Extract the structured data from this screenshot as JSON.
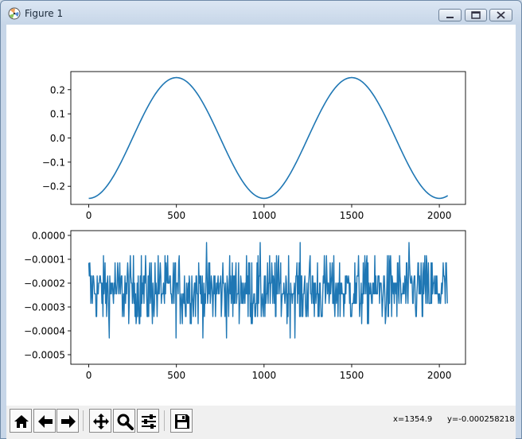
{
  "window": {
    "title": "Figure 1",
    "controls": [
      "minimize",
      "maximize",
      "close"
    ]
  },
  "toolbar": {
    "buttons": [
      {
        "name": "home",
        "icon": "home-icon"
      },
      {
        "name": "back",
        "icon": "arrow-left-icon"
      },
      {
        "name": "forward",
        "icon": "arrow-right-icon"
      },
      {
        "name": "pan",
        "icon": "move-icon"
      },
      {
        "name": "zoom",
        "icon": "magnifier-icon"
      },
      {
        "name": "configure-subplots",
        "icon": "sliders-icon"
      },
      {
        "name": "save",
        "icon": "floppy-disk-icon"
      }
    ],
    "x_readout": "x=1354.9",
    "y_readout": "y=-0.000258218"
  },
  "colors": {
    "series": "#1f77b4",
    "background": "#ffffff",
    "toolbar": "#f0f0f0"
  },
  "chart_data": [
    {
      "type": "line",
      "function": "-0.25*cos(2*pi*x/1000)",
      "x_range": [
        0,
        2048
      ],
      "xlim": [
        -102.35,
        2149.35
      ],
      "ylim": [
        -0.275,
        0.275
      ],
      "xticks": [
        0,
        500,
        1000,
        1500,
        2000
      ],
      "xtick_labels": [
        "0",
        "500",
        "1000",
        "1500",
        "2000"
      ],
      "yticks": [
        -0.2,
        -0.1,
        0.0,
        0.1,
        0.2
      ],
      "ytick_labels": [
        "−0.2",
        "−0.1",
        "0.0",
        "0.1",
        "0.2"
      ],
      "sample_points": [
        {
          "x": 0,
          "y": -0.25
        },
        {
          "x": 250,
          "y": 0.0
        },
        {
          "x": 500,
          "y": 0.25
        },
        {
          "x": 750,
          "y": 0.0
        },
        {
          "x": 1000,
          "y": -0.25
        },
        {
          "x": 1250,
          "y": 0.0
        },
        {
          "x": 1500,
          "y": 0.25
        },
        {
          "x": 1750,
          "y": 0.0
        },
        {
          "x": 2000,
          "y": -0.25
        },
        {
          "x": 2048,
          "y": -0.22
        }
      ]
    },
    {
      "type": "line",
      "x_range": [
        0,
        2048
      ],
      "xlim": [
        -102.35,
        2149.35
      ],
      "ylim": [
        -0.00054,
        2e-05
      ],
      "xticks": [
        0,
        500,
        1000,
        1500,
        2000
      ],
      "xtick_labels": [
        "0",
        "500",
        "1000",
        "1500",
        "2000"
      ],
      "yticks": [
        -0.0005,
        -0.0004,
        -0.0003,
        -0.0002,
        -0.0001,
        0.0
      ],
      "ytick_labels": [
        "−0.0005",
        "−0.0004",
        "−0.0003",
        "−0.0002",
        "−0.0001",
        "0.0000"
      ],
      "y_levels": [
        0.0,
        -3e-05,
        -8.5e-05,
        -0.000115,
        -0.00017,
        -0.0002,
        -0.000245,
        -0.000285,
        -0.00034,
        -0.00037,
        -0.00043,
        -0.00046,
        -0.00051
      ],
      "noise_center": -0.00023,
      "noise_std": 8e-05,
      "n_points": 2048
    }
  ]
}
